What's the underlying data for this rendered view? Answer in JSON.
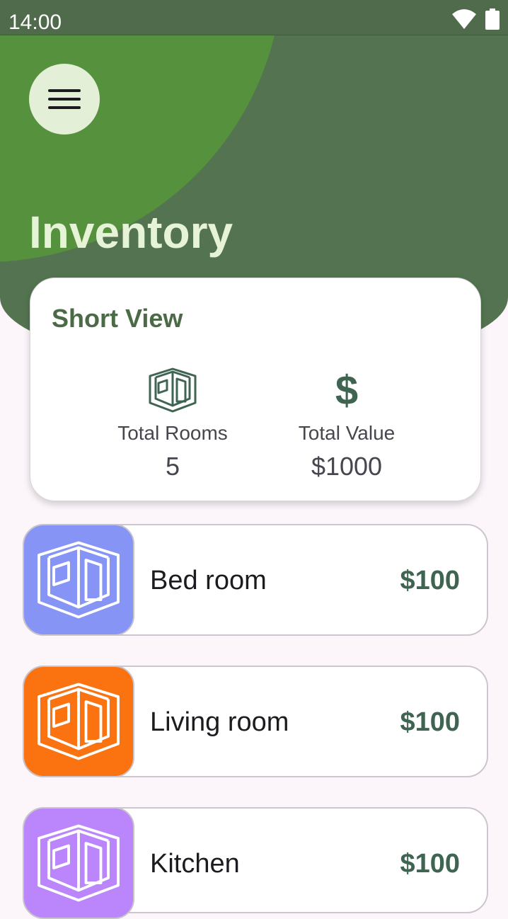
{
  "status_bar": {
    "time": "14:00",
    "icons": [
      "wifi-icon",
      "battery-icon"
    ]
  },
  "header": {
    "title": "Inventory",
    "menu_icon": "hamburger-menu-icon"
  },
  "short_view": {
    "title": "Short View",
    "total_rooms": {
      "label": "Total Rooms",
      "value": "5",
      "icon": "room-cube-icon"
    },
    "total_value": {
      "label": "Total Value",
      "value": "$1000",
      "icon": "dollar-icon"
    }
  },
  "rooms": [
    {
      "name": "Bed room",
      "price": "$100",
      "color": "#8594f5",
      "icon": "room-cube-icon"
    },
    {
      "name": "Living room",
      "price": "$100",
      "color": "#fb7210",
      "icon": "room-cube-icon"
    },
    {
      "name": "Kitchen",
      "price": "$100",
      "color": "#bb86fc",
      "icon": "room-cube-icon"
    }
  ],
  "colors": {
    "header_dark": "#547451",
    "header_light": "#56913d",
    "accent_text": "#4b6b46",
    "price_text": "#3f6552"
  }
}
